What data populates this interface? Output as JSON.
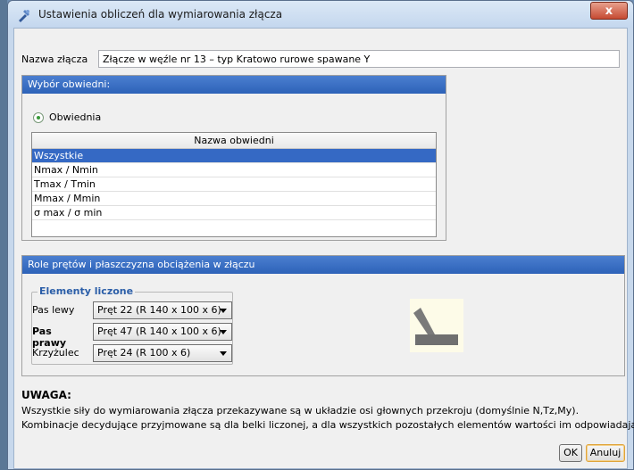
{
  "window": {
    "title": "Ustawienia obliczeń dla wymiarowania złącza",
    "close_label": "x"
  },
  "name_field": {
    "label": "Nazwa złącza",
    "value": "Złącze w węźle nr 13 – typ Kratowo rurowe spawane Y"
  },
  "envelope_group": {
    "header": "Wybór obwiedni:",
    "radio_label": "Obwiednia",
    "table_header": "Nazwa obwiedni",
    "rows": [
      "Wszystkie",
      "Nmax / Nmin",
      "Tmax / Tmin",
      "Mmax / Mmin",
      "σ max / σ min"
    ],
    "selected_index": 0
  },
  "roles_group": {
    "header": "Role prętów i płaszczyzna obciążenia w złączu",
    "legend": "Elementy liczone",
    "elements": [
      {
        "label": "Pas lewy",
        "value": "Pręt 22 (R 140 x 100 x 6)"
      },
      {
        "label": "Pas prawy",
        "value": "Pręt 47 (R 140 x 100 x 6)"
      },
      {
        "label": "Krzyżulec",
        "value": "Pręt 24 (R 100 x 6)"
      }
    ]
  },
  "warning": {
    "title": "UWAGA:",
    "line1": "Wszystkie siły do wymiarowania złącza przekazywane są w układzie osi głownych przekroju (domyślnie N,Tz,My).",
    "line2": "Kombinacje decydujące przyjmowane są dla belki liczonej, a dla wszystkich pozostałych elementów wartości im odpowiadające."
  },
  "buttons": {
    "ok": "OK",
    "cancel": "Anuluj"
  },
  "colors": {
    "group_header": "#2d62b8",
    "selection": "#3569c4",
    "legend_text": "#2b5ea8"
  }
}
